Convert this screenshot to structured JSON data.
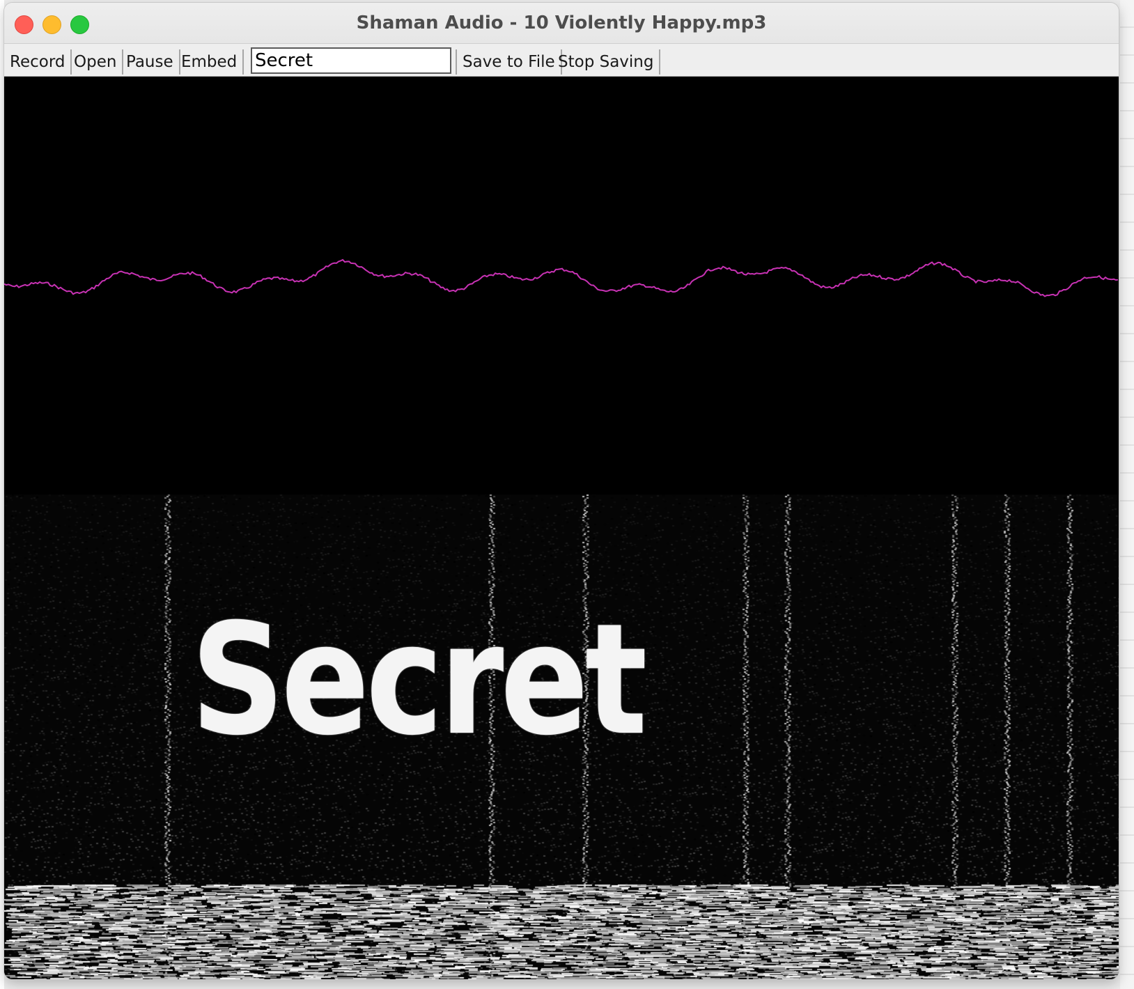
{
  "window": {
    "title": "Shaman Audio - 10 Violently Happy.mp3"
  },
  "toolbar": {
    "record_label": "Record",
    "open_label": "Open",
    "pause_label": "Pause",
    "embed_label": "Embed",
    "embed_text_value": "Secret",
    "save_to_file_label": "Save to File",
    "stop_saving_label": "Stop Saving"
  },
  "waveform": {
    "line_color": "#c832b4",
    "background": "#000000"
  },
  "spectrogram": {
    "embedded_text": "Secret",
    "background": "#050505",
    "foreground": "#ffffff"
  }
}
